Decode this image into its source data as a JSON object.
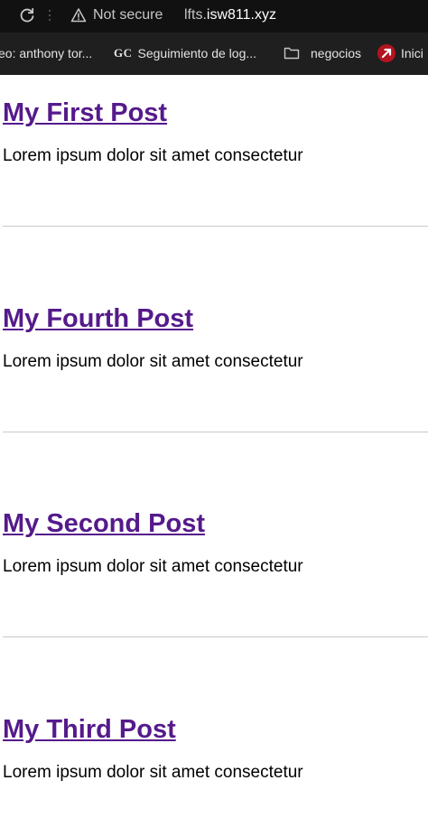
{
  "browser": {
    "security_label": "Not secure",
    "url_prefix": "lfts.",
    "url_host": "isw811.xyz",
    "bookmarks": [
      {
        "label": "eo: anthony tor...",
        "icon": "none"
      },
      {
        "label": "Seguimiento de log...",
        "icon": "gc-logo",
        "logo_text": "GC"
      },
      {
        "label": "negocios",
        "icon": "folder-icon"
      },
      {
        "label": "Inici",
        "icon": "arrow-badge-icon"
      }
    ],
    "colors": {
      "toolbar_bg": "#111111",
      "bookmarks_bg": "#1f1f1f",
      "badge_red": "#b3141f"
    }
  },
  "posts": [
    {
      "title": "My First Post",
      "excerpt": "Lorem ipsum dolor sit amet consectetur"
    },
    {
      "title": "My Fourth Post",
      "excerpt": "Lorem ipsum dolor sit amet consectetur"
    },
    {
      "title": "My Second Post",
      "excerpt": "Lorem ipsum dolor sit amet consectetur"
    },
    {
      "title": "My Third Post",
      "excerpt": "Lorem ipsum dolor sit amet consectetur"
    }
  ],
  "colors": {
    "link_visited": "#551a8b",
    "body_text": "#000000",
    "divider": "#c8c8c8"
  }
}
